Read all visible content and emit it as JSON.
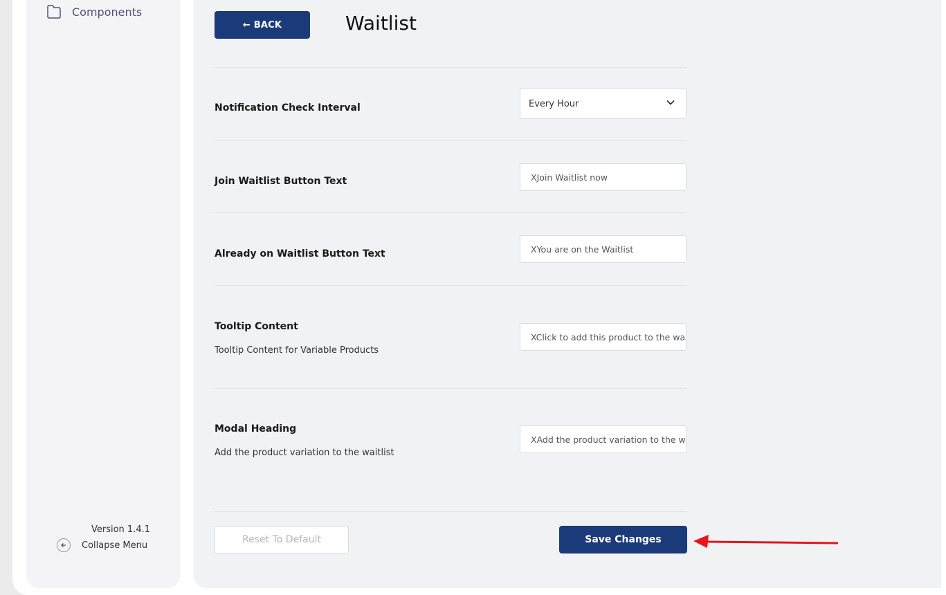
{
  "colors": {
    "primary": "#1b3a7a",
    "annotation_arrow": "#e8151b",
    "panel_bg": "#f1f2f4",
    "sidebar_bg": "#f4f4f7"
  },
  "sidebar": {
    "item_label": "Components",
    "item_icon": "folder-icon",
    "version": "Version 1.4.1",
    "collapse_label": "Collapse Menu",
    "collapse_icon": "arrow-left-circle-icon"
  },
  "header": {
    "back_label": "← BACK",
    "title": "Waitlist"
  },
  "settings": {
    "notification_interval": {
      "label": "Notification Check Interval",
      "value": "Every Hour"
    },
    "join_button_text": {
      "label": "Join Waitlist Button Text",
      "value": "XJoin Waitlist now"
    },
    "already_button_text": {
      "label": "Already on Waitlist Button Text",
      "value": "XYou are on the Waitlist"
    },
    "tooltip_content": {
      "label": "Tooltip Content",
      "description": "Tooltip Content for Variable Products",
      "value": "XClick to add this product to the waitlist"
    },
    "modal_heading": {
      "label": "Modal Heading",
      "description": "Add the product variation to the waitlist",
      "value": "XAdd the product variation to the waitlist"
    }
  },
  "footer": {
    "reset_label": "Reset To Default",
    "save_label": "Save Changes"
  }
}
